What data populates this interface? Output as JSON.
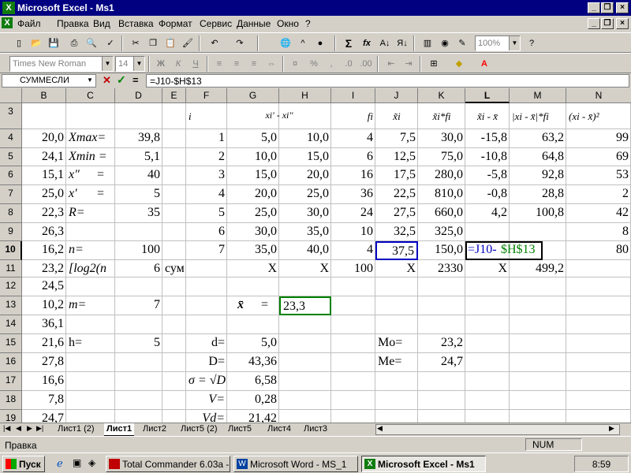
{
  "window": {
    "title": "Microsoft Excel - Ms1",
    "app_letter": "X"
  },
  "menu": [
    "Файл",
    "Правка",
    "Вид",
    "Вставка",
    "Формат",
    "Сервис",
    "Данные",
    "Окно",
    "?"
  ],
  "toolbar": {
    "zoom": "100%",
    "sigma": "Σ",
    "fx": "fx"
  },
  "format": {
    "font": "Times New Roman",
    "size": "14",
    "bold": "Ж",
    "italic": "К",
    "underline": "Ч",
    "percent": "%",
    "comma": ","
  },
  "formula": {
    "name": "СУММЕСЛИ",
    "eq": "=",
    "cancel": "✕",
    "ok": "✓",
    "value": "=J10-$H$13"
  },
  "columns": [
    "B",
    "C",
    "D",
    "E",
    "F",
    "G",
    "H",
    "I",
    "J",
    "K",
    "L",
    "M",
    "N"
  ],
  "rows": [
    "3",
    "4",
    "5",
    "6",
    "7",
    "8",
    "9",
    "10",
    "11",
    "12",
    "13",
    "14",
    "15",
    "16",
    "17",
    "18",
    "19"
  ],
  "cells": {
    "F3": "i",
    "G3": "xi' - xi''",
    "I3": "fi",
    "J3": "x̃i",
    "K3": "x̃i*fi",
    "L3": "x̃i - x̄",
    "M3": "|xi - x̄|*fi",
    "N3": "(xi - x̄)²",
    "B4": "20,0",
    "C4": "Xmax=",
    "D4": "39,8",
    "F4": "1",
    "G4": "5,0",
    "H4": "10,0",
    "I4": "4",
    "J4": "7,5",
    "K4": "30,0",
    "L4": "-15,8",
    "M4": "63,2",
    "N4": "99",
    "B5": "24,1",
    "C5": "Xmin =",
    "D5": "5,1",
    "F5": "2",
    "G5": "10,0",
    "H5": "15,0",
    "I5": "6",
    "J5": "12,5",
    "K5": "75,0",
    "L5": "-10,8",
    "M5": "64,8",
    "N5": "69",
    "B6": "15,1",
    "C6": "x\"",
    "C6b": "=",
    "D6": "40",
    "F6": "3",
    "G6": "15,0",
    "H6": "20,0",
    "I6": "16",
    "J6": "17,5",
    "K6": "280,0",
    "L6": "-5,8",
    "M6": "92,8",
    "N6": "53",
    "B7": "25,0",
    "C7": "x'",
    "C7b": "=",
    "D7": "5",
    "F7": "4",
    "G7": "20,0",
    "H7": "25,0",
    "I7": "36",
    "J7": "22,5",
    "K7": "810,0",
    "L7": "-0,8",
    "M7": "28,8",
    "N7": "2",
    "B8": "22,3",
    "C8": "R=",
    "D8": "35",
    "F8": "5",
    "G8": "25,0",
    "H8": "30,0",
    "I8": "24",
    "J8": "27,5",
    "K8": "660,0",
    "L8": "4,2",
    "M8": "100,8",
    "N8": "42",
    "B9": "26,3",
    "F9": "6",
    "G9": "30,0",
    "H9": "35,0",
    "I9": "10",
    "J9": "32,5",
    "K9": "325,0",
    "N9": "8",
    "B10": "16,2",
    "C10": "n=",
    "D10": "100",
    "F10": "7",
    "G10": "35,0",
    "H10": "40,0",
    "I10": "4",
    "J10": "37,5",
    "K10": "150,0",
    "L10a": "=J10-",
    "L10b": "$H$13",
    "N10": "80",
    "B11": "23,2",
    "C11": "[log2(n",
    "D11": "6",
    "E11": "сум",
    "G11": "X",
    "H11": "X",
    "I11": "100",
    "J11": "X",
    "K11": "2330",
    "L11": "X",
    "M11": "499,2",
    "B12": "24,5",
    "B13": "10,2",
    "C13": "m=",
    "D13": "7",
    "G13": "x̄",
    "G13b": "=",
    "H13": "23,3",
    "B14": "36,1",
    "B15": "21,6",
    "C15": "h=",
    "D15": "5",
    "F15": "d=",
    "G15": "5,0",
    "J15": "Mo=",
    "K15": "23,2",
    "B16": "27,8",
    "F16": "D=",
    "G16": "43,36",
    "J16": "Me=",
    "K16": "24,7",
    "B17": "16,6",
    "F17": "σ = √D",
    "G17": "6,58",
    "B18": "7,8",
    "F18": "V=",
    "G18": "0,28",
    "B19": "24,7",
    "F19": "Vd=",
    "G19": "21,42"
  },
  "sheets": [
    "Лист1 (2)",
    "Лист1",
    "Лист2",
    "Лист5 (2)",
    "Лист5",
    "Лист4",
    "Лист3"
  ],
  "status": {
    "left": "Правка",
    "num": "NUM"
  },
  "taskbar": {
    "start": "Пуск",
    "items": [
      "Total Commander 6.03a - ...",
      "Microsoft Word - MS_1",
      "Microsoft Excel - Ms1"
    ],
    "clock": "8:59"
  }
}
